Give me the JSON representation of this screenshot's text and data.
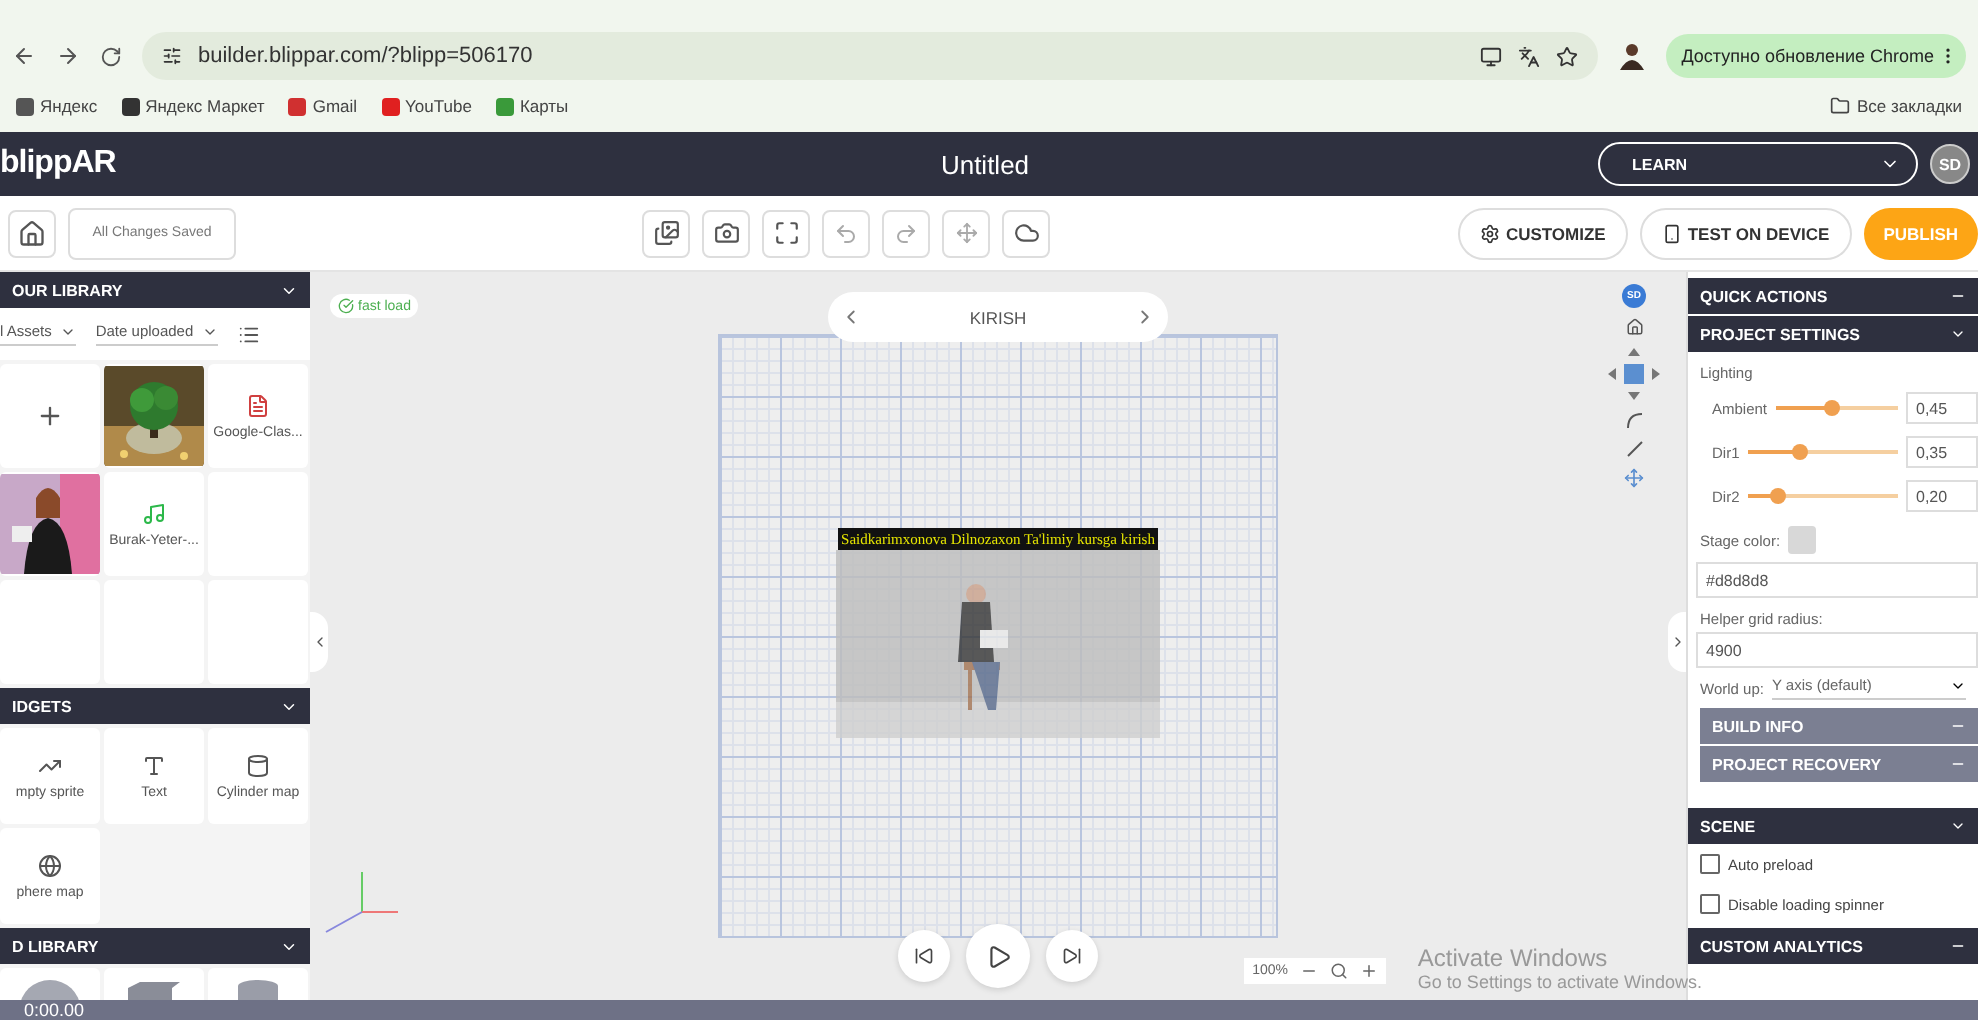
{
  "browser": {
    "url": "builder.blippar.com/?blipp=506170",
    "update": "Доступно обновление Chrome",
    "bookmarks": [
      "Яндекс",
      "Яндекс Маркет",
      "Gmail",
      "YouTube",
      "Карты"
    ],
    "all_bookmarks": "Все закладки"
  },
  "header": {
    "logo": "blippAR",
    "title": "Untitled",
    "learn": "LEARN",
    "avatar": "SD"
  },
  "toolbar": {
    "status": "All Changes Saved",
    "customize": "CUSTOMIZE",
    "test": "TEST ON DEVICE",
    "publish": "PUBLISH"
  },
  "library": {
    "title": "OUR LIBRARY",
    "filter": "l Assets",
    "sort": "Date uploaded",
    "assets": [
      {
        "kind": "add"
      },
      {
        "kind": "picture"
      },
      {
        "kind": "pdf",
        "label": "Google-Clas..."
      },
      {
        "kind": "picture"
      },
      {
        "kind": "audio",
        "label": "Burak-Yeter-..."
      },
      {
        "kind": "empty"
      },
      {
        "kind": "empty"
      },
      {
        "kind": "empty"
      },
      {
        "kind": "empty"
      }
    ]
  },
  "widgets": {
    "title": "IDGETS",
    "items": [
      {
        "kind": "sprite",
        "label": "mpty sprite"
      },
      {
        "kind": "text",
        "label": "Text"
      },
      {
        "kind": "cylinder",
        "label": "Cylinder map"
      },
      {
        "kind": "sphere",
        "label": "phere map"
      }
    ]
  },
  "models": {
    "title": "D LIBRARY",
    "items": [
      {
        "kind": "sphere"
      },
      {
        "kind": "cube"
      },
      {
        "kind": "cylinder"
      }
    ]
  },
  "canvas": {
    "fast_load": "fast load",
    "scene": "KIRISH",
    "badge": "SD",
    "caption": "Saidkarimxonova  Dilnozaxon Ta'limiy kursga kirish",
    "zoom": "100%",
    "notice_title": "Activate Windows",
    "notice_text": "Go to Settings to activate Windows."
  },
  "settings": {
    "quick_actions": "QUICK ACTIONS",
    "project_settings": "PROJECT SETTINGS",
    "lighting": "Lighting",
    "lights": [
      {
        "name": "Ambient",
        "level": 0.47,
        "reading": "0,45"
      },
      {
        "name": "Dir1",
        "level": 0.35,
        "reading": "0,35"
      },
      {
        "name": "Dir2",
        "level": 0.2,
        "reading": "0,20"
      }
    ],
    "stage_color_label": "Stage color:",
    "stage_color": "#d8d8d8",
    "grid_label": "Helper grid radius:",
    "grid_value": "4900",
    "world_label": "World up:",
    "world_value": "Y axis (default)",
    "build_info": "BUILD INFO",
    "recovery": "PROJECT RECOVERY",
    "scene": "SCENE",
    "options": [
      {
        "label": "Auto preload",
        "checked": false
      },
      {
        "label": "Disable loading spinner",
        "checked": false
      }
    ],
    "analytics": "CUSTOM ANALYTICS"
  },
  "timeline": {
    "time": "0:00.00"
  }
}
